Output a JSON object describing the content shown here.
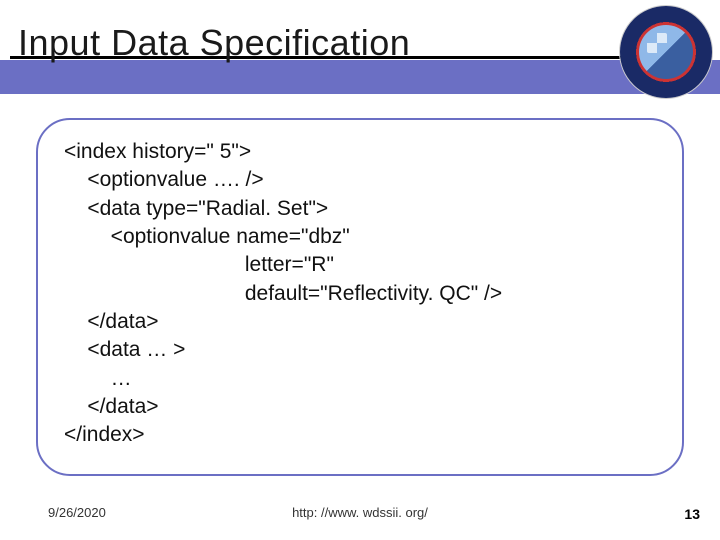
{
  "title": "Input Data Specification",
  "logo_name": "nssl-logo",
  "code_lines": {
    "l0": "<index history=\" 5\">",
    "l1": "    <optionvalue …. />",
    "l2": "    <data type=\"Radial. Set\">",
    "l3": "        <optionvalue name=\"dbz\"",
    "l4": "                               letter=\"R\"",
    "l5": "                               default=\"Reflectivity. QC\" />",
    "l6": "    </data>",
    "l7": "    <data … >",
    "l8": "        …",
    "l9": "    </data>",
    "l10": "</index>"
  },
  "footer": {
    "date": "9/26/2020",
    "url": "http: //www. wdssii. org/",
    "page": "13"
  }
}
